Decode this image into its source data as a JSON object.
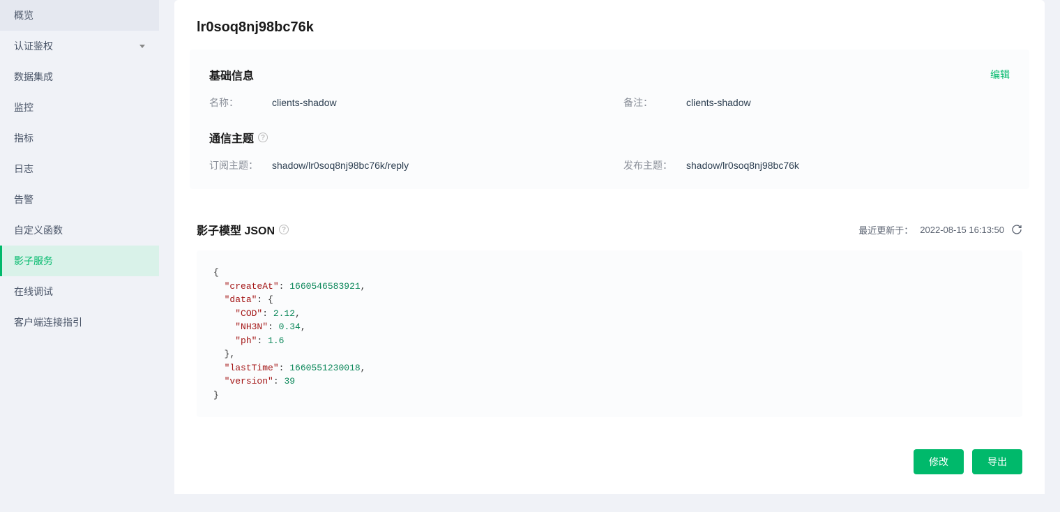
{
  "sidebar": {
    "items": [
      {
        "label": "概览",
        "expandable": false
      },
      {
        "label": "认证鉴权",
        "expandable": true
      },
      {
        "label": "数据集成",
        "expandable": false
      },
      {
        "label": "监控",
        "expandable": false
      },
      {
        "label": "指标",
        "expandable": false
      },
      {
        "label": "日志",
        "expandable": false
      },
      {
        "label": "告警",
        "expandable": false
      },
      {
        "label": "自定义函数",
        "expandable": false
      },
      {
        "label": "影子服务",
        "expandable": false,
        "active": true
      },
      {
        "label": "在线调试",
        "expandable": false
      },
      {
        "label": "客户端连接指引",
        "expandable": false
      }
    ]
  },
  "page": {
    "title": "lr0soq8nj98bc76k"
  },
  "basic": {
    "section_title": "基础信息",
    "edit_label": "编辑",
    "name_label": "名称：",
    "name_value": "clients-shadow",
    "note_label": "备注：",
    "note_value": "clients-shadow"
  },
  "topics": {
    "section_title": "通信主题",
    "sub_label": "订阅主题：",
    "sub_value": "shadow/lr0soq8nj98bc76k/reply",
    "pub_label": "发布主题：",
    "pub_value": "shadow/lr0soq8nj98bc76k"
  },
  "json_model": {
    "section_title": "影子模型 JSON",
    "updated_label": "最近更新于：",
    "updated_value": "2022-08-15 16:13:50",
    "data": {
      "createAt": 1660546583921,
      "data": {
        "COD": 2.12,
        "NH3N": 0.34,
        "ph": 1.6
      },
      "lastTime": 1660551230018,
      "version": 39
    }
  },
  "actions": {
    "modify_label": "修改",
    "export_label": "导出"
  }
}
